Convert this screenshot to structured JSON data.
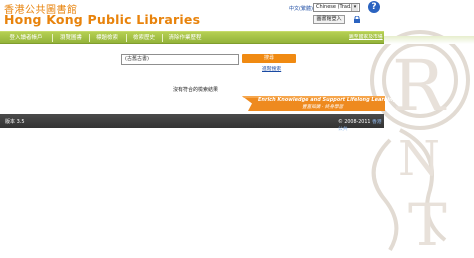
{
  "header": {
    "logo_zh": "香港公共圖書館",
    "logo_en": "Hong Kong Public Libraries",
    "language_label": "中文(繁體)",
    "language_selected": "Chinese (Trad.)",
    "login_label": "圖書館登入",
    "help_icon": "help-icon",
    "lock_icon": "lock-icon"
  },
  "nav": {
    "items": [
      {
        "label": "登入讀者帳戶"
      },
      {
        "label": "瀏覽圖書"
      },
      {
        "label": "標題檢索"
      },
      {
        "label": "檢索歷史"
      },
      {
        "label": "清除作業歷程"
      }
    ],
    "advanced_link": "跳至國家及市場"
  },
  "search": {
    "value": "(古舊古書)",
    "button_label": "搜尋",
    "advanced_label": "進階搜索"
  },
  "result_message": "沒有符合的檢索結果",
  "banner": {
    "en": "Enrich Knowledge and Support Lifelong Learning",
    "zh": "豐富知識 · 終身學習"
  },
  "footer": {
    "version": "版本 3.5",
    "copyright": "© 2008-2011",
    "copyright_tail": "香港公共"
  },
  "colors": {
    "brand_orange": "#e8830c",
    "nav_green": "#a4c048",
    "footer_dark": "#3c3c3c",
    "link_blue": "#1a4aa3"
  }
}
